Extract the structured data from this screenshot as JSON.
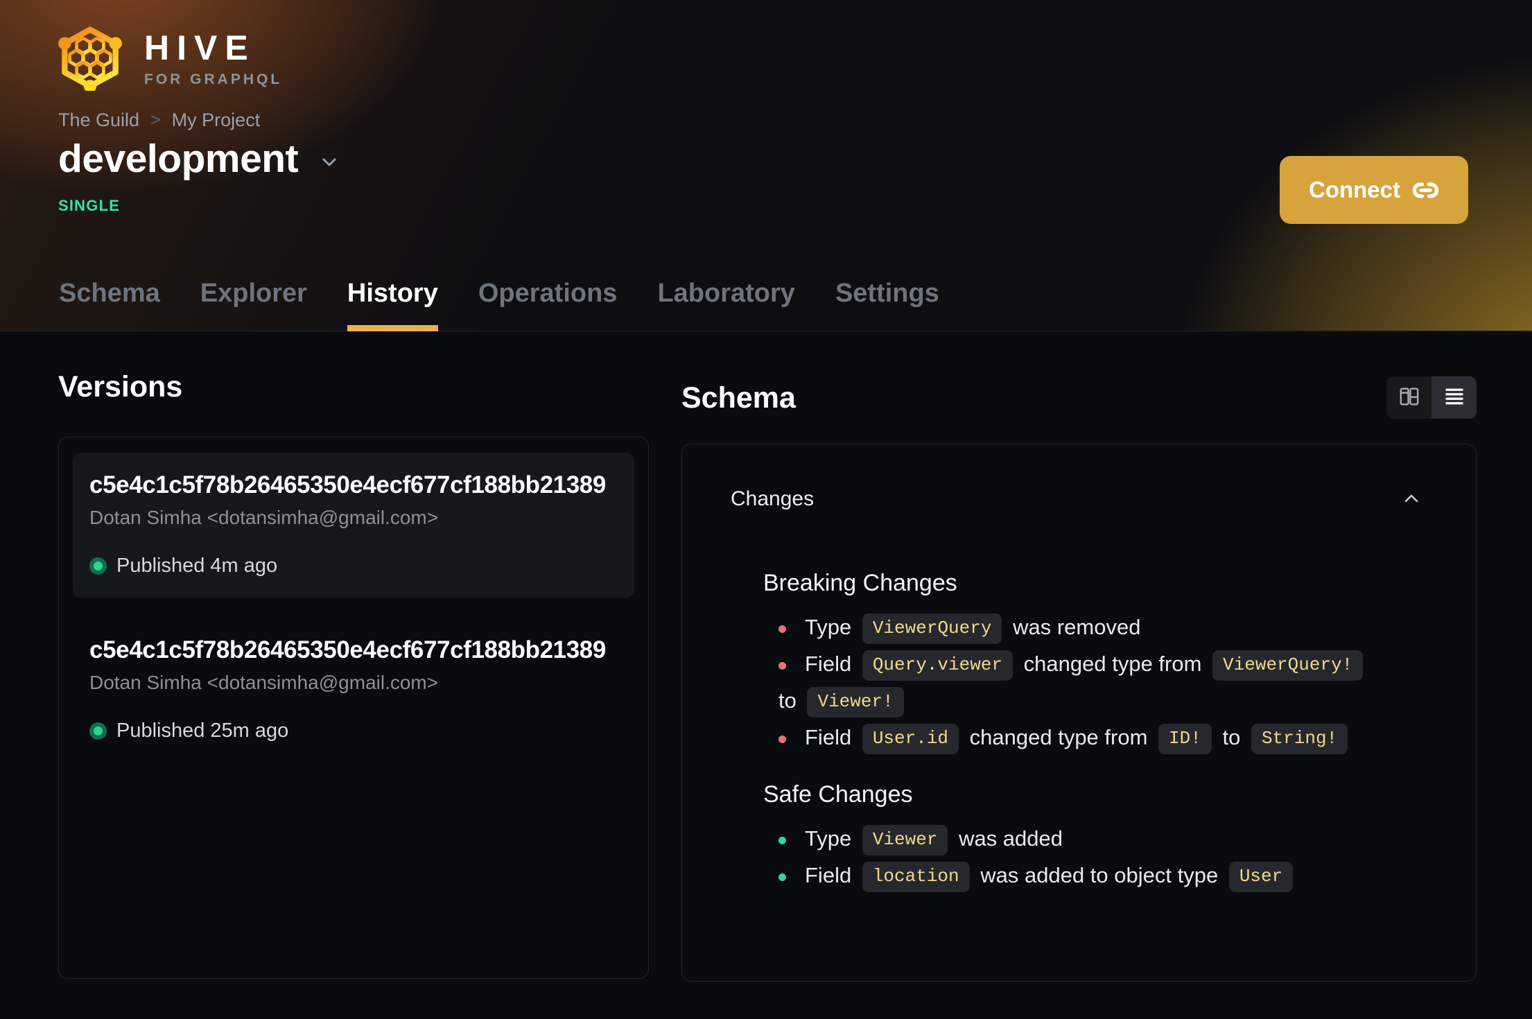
{
  "brand": {
    "name": "HIVE",
    "tagline": "FOR GRAPHQL"
  },
  "breadcrumb": {
    "org": "The Guild",
    "separator": ">",
    "project": "My Project"
  },
  "target": {
    "name": "development",
    "type_badge": "SINGLE"
  },
  "connect_button": {
    "label": "Connect",
    "icon": "link-icon"
  },
  "tabs": [
    {
      "label": "Schema",
      "active": false
    },
    {
      "label": "Explorer",
      "active": false
    },
    {
      "label": "History",
      "active": true
    },
    {
      "label": "Operations",
      "active": false
    },
    {
      "label": "Laboratory",
      "active": false
    },
    {
      "label": "Settings",
      "active": false
    }
  ],
  "versions_panel": {
    "heading": "Versions",
    "items": [
      {
        "hash": "c5e4c1c5f78b26465350e4ecf677cf188bb21389",
        "author": "Dotan Simha <dotansimha@gmail.com>",
        "status": "Published 4m ago",
        "highlighted": true
      },
      {
        "hash": "c5e4c1c5f78b26465350e4ecf677cf188bb21389",
        "author": "Dotan Simha <dotansimha@gmail.com>",
        "status": "Published 25m ago",
        "highlighted": false
      }
    ]
  },
  "schema_panel": {
    "heading": "Schema",
    "view_toggle": [
      {
        "name": "diff-view",
        "icon": "columns-icon",
        "active": false
      },
      {
        "name": "list-view",
        "icon": "list-icon",
        "active": true
      }
    ],
    "changes": {
      "label": "Changes",
      "collapsed": false,
      "sections": [
        {
          "title": "Breaking Changes",
          "kind": "breaking",
          "items": [
            [
              {
                "text": "Type "
              },
              {
                "code": "ViewerQuery"
              },
              {
                "text": " was removed"
              }
            ],
            [
              {
                "text": "Field "
              },
              {
                "code": "Query.viewer"
              },
              {
                "text": " changed type from "
              },
              {
                "code": "ViewerQuery!"
              },
              {
                "text": " to "
              },
              {
                "code": "Viewer!"
              }
            ],
            [
              {
                "text": "Field "
              },
              {
                "code": "User.id"
              },
              {
                "text": " changed type from "
              },
              {
                "code": "ID!"
              },
              {
                "text": " to "
              },
              {
                "code": "String!"
              }
            ]
          ]
        },
        {
          "title": "Safe Changes",
          "kind": "safe",
          "items": [
            [
              {
                "text": "Type "
              },
              {
                "code": "Viewer"
              },
              {
                "text": " was added"
              }
            ],
            [
              {
                "text": "Field "
              },
              {
                "code": "location"
              },
              {
                "text": " was added to object type "
              },
              {
                "code": "User"
              }
            ]
          ]
        }
      ]
    }
  },
  "colors": {
    "accent_gold": "#d7a33c",
    "tab_underline": "#edb14a",
    "badge_green": "#2ee6a6",
    "published_green": "#2ed58e",
    "breaking_bullet": "#e5737d",
    "safe_bullet": "#34d399",
    "chip_text": "#f3d88c",
    "chip_bg": "#26282d",
    "header_glow_orange": "#bd6026",
    "header_glow_gold": "#d8a42c"
  }
}
